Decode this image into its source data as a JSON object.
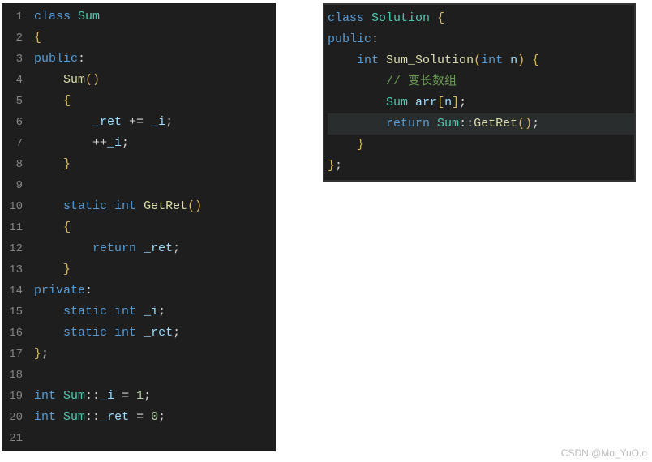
{
  "left": {
    "gutter": [
      "1",
      "2",
      "3",
      "4",
      "5",
      "6",
      "7",
      "8",
      "9",
      "10",
      "11",
      "12",
      "13",
      "14",
      "15",
      "16",
      "17",
      "18",
      "19",
      "20",
      "21"
    ],
    "lines": [
      [
        [
          "kw",
          "class"
        ],
        [
          "wht",
          " "
        ],
        [
          "cls",
          "Sum"
        ]
      ],
      [
        [
          "punc",
          "{"
        ]
      ],
      [
        [
          "kw",
          "public"
        ],
        [
          "wht",
          ":"
        ]
      ],
      [
        [
          "wht",
          "    "
        ],
        [
          "fn",
          "Sum"
        ],
        [
          "punc",
          "()"
        ]
      ],
      [
        [
          "wht",
          "    "
        ],
        [
          "punc",
          "{"
        ]
      ],
      [
        [
          "wht",
          "        "
        ],
        [
          "var",
          "_ret"
        ],
        [
          "wht",
          " "
        ],
        [
          "op",
          "+="
        ],
        [
          "wht",
          " "
        ],
        [
          "var",
          "_i"
        ],
        [
          "wht",
          ";"
        ]
      ],
      [
        [
          "wht",
          "        "
        ],
        [
          "op",
          "++"
        ],
        [
          "var",
          "_i"
        ],
        [
          "wht",
          ";"
        ]
      ],
      [
        [
          "wht",
          "    "
        ],
        [
          "punc",
          "}"
        ]
      ],
      [],
      [
        [
          "wht",
          "    "
        ],
        [
          "kw",
          "static"
        ],
        [
          "wht",
          " "
        ],
        [
          "kw",
          "int"
        ],
        [
          "wht",
          " "
        ],
        [
          "fn",
          "GetRet"
        ],
        [
          "punc",
          "()"
        ]
      ],
      [
        [
          "wht",
          "    "
        ],
        [
          "punc",
          "{"
        ]
      ],
      [
        [
          "wht",
          "        "
        ],
        [
          "kw",
          "return"
        ],
        [
          "wht",
          " "
        ],
        [
          "var",
          "_ret"
        ],
        [
          "wht",
          ";"
        ]
      ],
      [
        [
          "wht",
          "    "
        ],
        [
          "punc",
          "}"
        ]
      ],
      [
        [
          "kw",
          "private"
        ],
        [
          "wht",
          ":"
        ]
      ],
      [
        [
          "wht",
          "    "
        ],
        [
          "kw",
          "static"
        ],
        [
          "wht",
          " "
        ],
        [
          "kw",
          "int"
        ],
        [
          "wht",
          " "
        ],
        [
          "var",
          "_i"
        ],
        [
          "wht",
          ";"
        ]
      ],
      [
        [
          "wht",
          "    "
        ],
        [
          "kw",
          "static"
        ],
        [
          "wht",
          " "
        ],
        [
          "kw",
          "int"
        ],
        [
          "wht",
          " "
        ],
        [
          "var",
          "_ret"
        ],
        [
          "wht",
          ";"
        ]
      ],
      [
        [
          "punc",
          "}"
        ],
        [
          "wht",
          ";"
        ]
      ],
      [],
      [
        [
          "kw",
          "int"
        ],
        [
          "wht",
          " "
        ],
        [
          "cls",
          "Sum"
        ],
        [
          "wht",
          "::"
        ],
        [
          "var",
          "_i"
        ],
        [
          "wht",
          " = "
        ],
        [
          "num",
          "1"
        ],
        [
          "wht",
          ";"
        ]
      ],
      [
        [
          "kw",
          "int"
        ],
        [
          "wht",
          " "
        ],
        [
          "cls",
          "Sum"
        ],
        [
          "wht",
          "::"
        ],
        [
          "var",
          "_ret"
        ],
        [
          "wht",
          " = "
        ],
        [
          "num",
          "0"
        ],
        [
          "wht",
          ";"
        ]
      ],
      []
    ]
  },
  "right": {
    "highlight_index": 5,
    "lines": [
      [
        [
          "kw",
          "class"
        ],
        [
          "wht",
          " "
        ],
        [
          "cls",
          "Solution"
        ],
        [
          "wht",
          " "
        ],
        [
          "punc",
          "{"
        ]
      ],
      [
        [
          "kw",
          "public"
        ],
        [
          "wht",
          ":"
        ]
      ],
      [
        [
          "wht",
          "    "
        ],
        [
          "kw",
          "int"
        ],
        [
          "wht",
          " "
        ],
        [
          "fn",
          "Sum_Solution"
        ],
        [
          "punc",
          "("
        ],
        [
          "kw",
          "int"
        ],
        [
          "wht",
          " "
        ],
        [
          "id",
          "n"
        ],
        [
          "punc",
          ")"
        ],
        [
          "wht",
          " "
        ],
        [
          "punc",
          "{"
        ]
      ],
      [
        [
          "wht",
          "        "
        ],
        [
          "cmt",
          "// 变长数组"
        ]
      ],
      [
        [
          "wht",
          "        "
        ],
        [
          "cls",
          "Sum"
        ],
        [
          "wht",
          " "
        ],
        [
          "var",
          "arr"
        ],
        [
          "punc",
          "["
        ],
        [
          "id",
          "n"
        ],
        [
          "punc",
          "]"
        ],
        [
          "wht",
          ";"
        ]
      ],
      [
        [
          "wht",
          "        "
        ],
        [
          "kw",
          "return"
        ],
        [
          "wht",
          " "
        ],
        [
          "cls",
          "Sum"
        ],
        [
          "wht",
          "::"
        ],
        [
          "fn",
          "GetRet"
        ],
        [
          "punc",
          "()"
        ],
        [
          "wht",
          ";"
        ]
      ],
      [
        [
          "wht",
          "    "
        ],
        [
          "punc",
          "}"
        ]
      ],
      [
        [
          "punc",
          "}"
        ],
        [
          "wht",
          ";"
        ]
      ]
    ]
  },
  "watermark": "CSDN @Mo_YuO.o"
}
